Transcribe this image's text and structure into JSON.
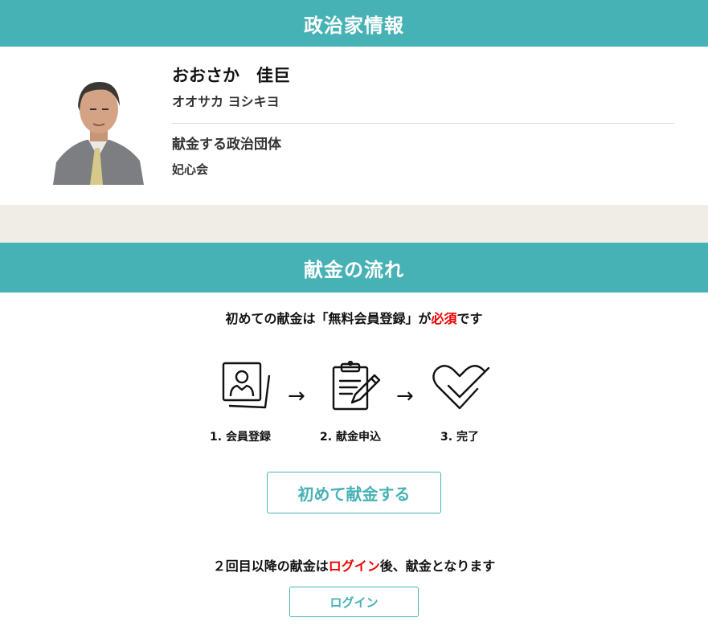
{
  "header": {
    "title": "政治家情報"
  },
  "politician": {
    "name": "おおさか　佳巨",
    "kana": "オオサカ ヨシキヨ",
    "org_label": "献金する政治団体",
    "org_name": "妃心会"
  },
  "flow": {
    "title": "献金の流れ",
    "lead_before": "初めての献金は「無料会員登録」が",
    "lead_required": "必須",
    "lead_after": "です",
    "steps": [
      {
        "label": "1. 会員登録",
        "icon": "member-card-icon"
      },
      {
        "label": "2. 献金申込",
        "icon": "clipboard-pen-icon"
      },
      {
        "label": "3. 完了",
        "icon": "heart-check-icon"
      }
    ],
    "arrow": "→",
    "first_button": "初めて献金する",
    "lead2_before": "２回目以降の献金は",
    "lead2_login": "ログイン",
    "lead2_after": "後、献金となります",
    "login_button": "ログイン"
  },
  "colors": {
    "accent": "#47b2b5",
    "required": "#e00000",
    "gap": "#efede6"
  }
}
